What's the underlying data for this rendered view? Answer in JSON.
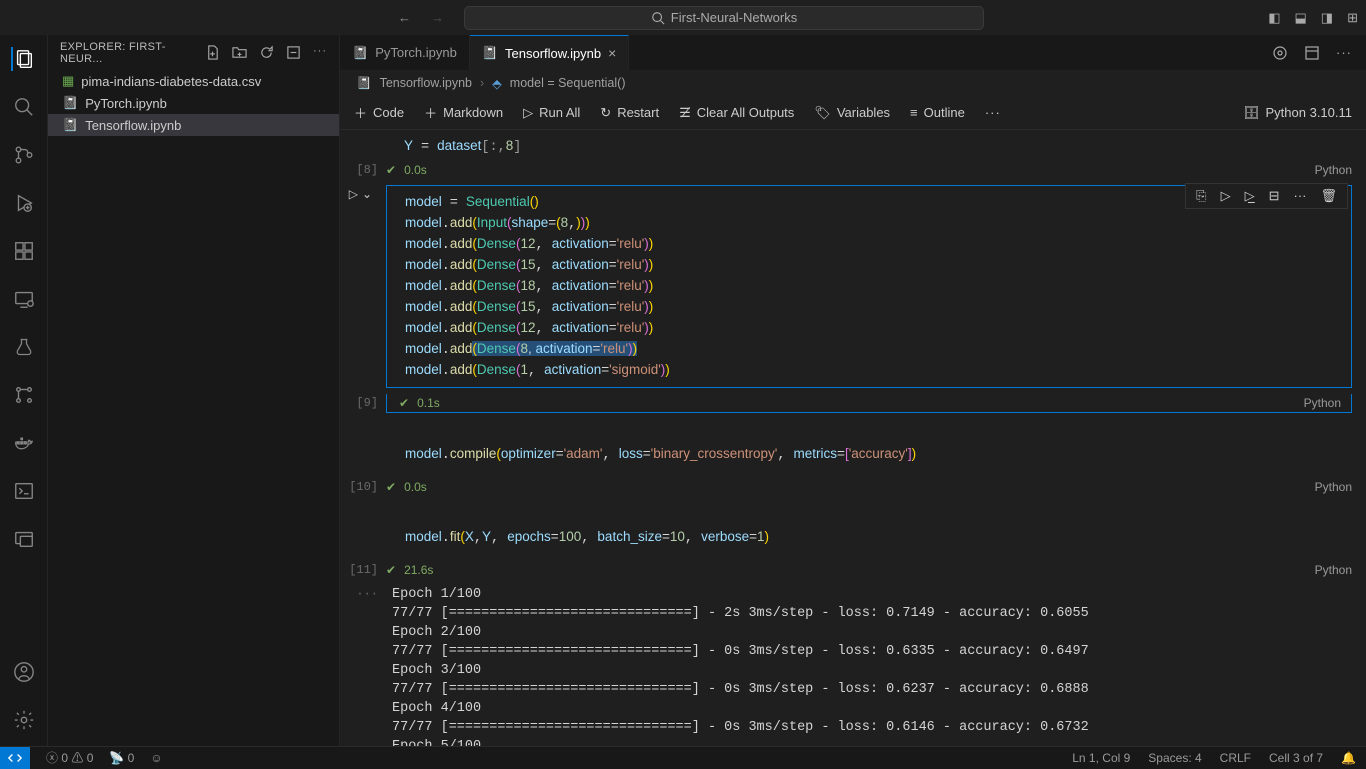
{
  "titlebar": {
    "search": "First-Neural-Networks"
  },
  "sidebar": {
    "title": "EXPLORER: FIRST-NEUR...",
    "files": [
      {
        "name": "pima-indians-diabetes-data.csv",
        "color": "green"
      },
      {
        "name": "PyTorch.ipynb",
        "color": "orange"
      },
      {
        "name": "Tensorflow.ipynb",
        "color": "orange"
      }
    ]
  },
  "tabs": {
    "items": [
      {
        "label": "PyTorch.ipynb"
      },
      {
        "label": "Tensorflow.ipynb"
      }
    ]
  },
  "breadcrumb": {
    "file": "Tensorflow.ipynb",
    "symbol": "model = Sequential()"
  },
  "toolbar": {
    "code": "Code",
    "markdown": "Markdown",
    "runall": "Run All",
    "restart": "Restart",
    "clear": "Clear All Outputs",
    "vars": "Variables",
    "outline": "Outline",
    "kernel": "Python 3.10.11"
  },
  "cells": {
    "prev_snip": "Y = dataset[:,8]",
    "c8": {
      "num": "[8]",
      "time": "0.0s",
      "lang": "Python"
    },
    "c9": {
      "num": "[9]",
      "time": "0.1s",
      "lang": "Python"
    },
    "c10": {
      "num": "[10]",
      "time": "0.0s",
      "lang": "Python"
    },
    "c11": {
      "num": "[11]",
      "time": "21.6s",
      "lang": "Python"
    }
  },
  "output_text": "Epoch 1/100\n77/77 [==============================] - 2s 3ms/step - loss: 0.7149 - accuracy: 0.6055\nEpoch 2/100\n77/77 [==============================] - 0s 3ms/step - loss: 0.6335 - accuracy: 0.6497\nEpoch 3/100\n77/77 [==============================] - 0s 3ms/step - loss: 0.6237 - accuracy: 0.6888\nEpoch 4/100\n77/77 [==============================] - 0s 3ms/step - loss: 0.6146 - accuracy: 0.6732\nEpoch 5/100",
  "statusbar": {
    "errors": "0",
    "warn": "0",
    "ports": "0",
    "ln": "Ln 1, Col 9",
    "spaces": "Spaces: 4",
    "eol": "CRLF",
    "cell": "Cell 3 of 7"
  }
}
